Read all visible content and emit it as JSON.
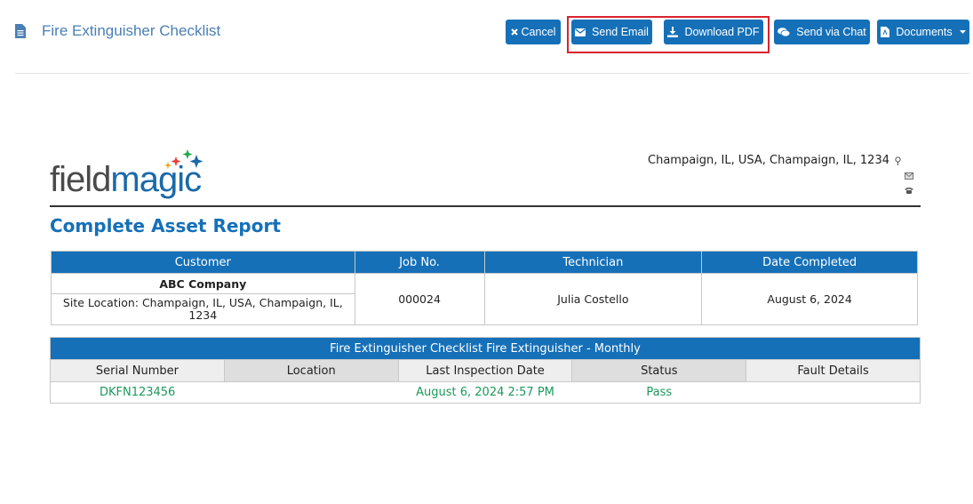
{
  "header": {
    "title": "Fire Extinguisher Checklist",
    "icon": "document-icon",
    "buttons": {
      "cancel": "Cancel",
      "send_email": "Send Email",
      "download_pdf": "Download PDF",
      "send_chat": "Send via Chat",
      "documents": "Documents"
    }
  },
  "colors": {
    "primary": "#1570b8",
    "highlight": "#d9232d",
    "status_ok": "#1a9a5a"
  },
  "company": {
    "logo_part1": "field",
    "logo_part2": "magic",
    "address": "Champaign, IL, USA, Champaign, IL, 1234"
  },
  "report": {
    "title": "Complete Asset Report",
    "summary": {
      "headers": [
        "Customer",
        "Job No.",
        "Technician",
        "Date Completed"
      ],
      "customer_name": "ABC Company",
      "site_location": "Site Location: Champaign, IL, USA, Champaign, IL, 1234",
      "job_no": "000024",
      "technician": "Julia Costello",
      "date_completed": "August 6, 2024"
    },
    "checklist": {
      "caption": "Fire Extinguisher Checklist Fire Extinguisher - Monthly",
      "headers": [
        "Serial Number",
        "Location",
        "Last Inspection Date",
        "Status",
        "Fault Details"
      ],
      "rows": [
        {
          "serial": "DKFN123456",
          "location": "",
          "last_inspection": "August 6, 2024 2:57 PM",
          "status": "Pass",
          "fault": ""
        }
      ]
    }
  }
}
